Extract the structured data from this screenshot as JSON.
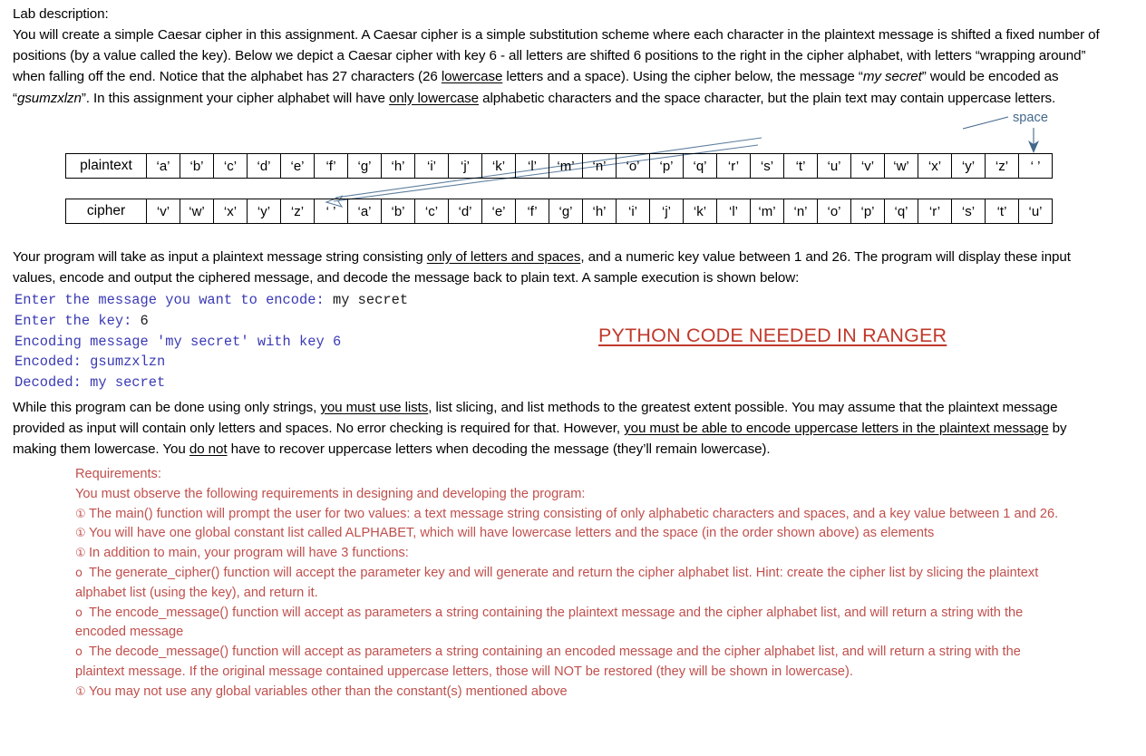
{
  "document": {
    "lab_label": "Lab description:",
    "intro_paragraph": {
      "seg1": "You will create a simple Caesar cipher in this assignment.  A Caesar cipher is a simple substitution scheme where each character in the plaintext message is shifted a fixed number of positions (by a value called the key).  Below we depict a Caesar cipher with key 6 - all letters are shifted 6 positions to the right in the cipher alphabet, with letters “wrapping around” when falling off the end.  Notice that the alphabet has 27 characters (26 ",
      "underline1": "lowercase",
      "seg2": " letters and a space).  Using the cipher below, the message “",
      "italic1": "my secret",
      "seg3": "” would be encoded as “",
      "italic2": "gsumzxlzn",
      "seg4": "”.  In this assignment your cipher alphabet will have ",
      "underline2": "only lowercase",
      "seg5": " alphabetic characters and the space character, but the plain text may contain uppercase letters."
    },
    "input_paragraph": {
      "seg1": "Your program will take as input a plaintext message string consisting ",
      "underline1": "only of letters and spaces",
      "seg2": ", and a numeric key value between 1 and 26.  The program will display these input values, encode and output the ciphered message, and decode the message back to plain text.  A sample execution is shown below:"
    },
    "lists_paragraph": {
      "seg1": "While this program can be done using only strings, ",
      "underline1": "you must use lists",
      "seg2": ", list slicing, and list methods to the greatest extent possible.  You may assume that the plaintext message provided as input will contain only letters and spaces.  No error checking is required for that.  However, ",
      "underline2": "you must be able to encode uppercase letters in the plaintext message",
      "seg3": " by making them lowercase. You ",
      "underline3": "do not",
      "seg4": " have to recover uppercase letters when decoding the message (they’ll remain lowercase)."
    }
  },
  "cipher_diagram": {
    "plaintext_label": "plaintext",
    "cipher_label": "cipher",
    "plaintext_cells": [
      "‘a’",
      "‘b’",
      "‘c’",
      "‘d’",
      "‘e’",
      "‘f’",
      "‘g’",
      "‘h’",
      "‘i’",
      "‘j’",
      "‘k’",
      "‘l’",
      "‘m’",
      "‘n’",
      "‘o’",
      "‘p’",
      "‘q’",
      "‘r’",
      "‘s’",
      "‘t’",
      "‘u’",
      "‘v’",
      "‘w’",
      "‘x’",
      "‘y’",
      "‘z’",
      "‘ ’"
    ],
    "cipher_cells": [
      "‘v’",
      "‘w’",
      "‘x’",
      "‘y’",
      "‘z’",
      "‘ ’",
      "‘a’",
      "‘b’",
      "‘c’",
      "‘d’",
      "‘e’",
      "‘f’",
      "‘g’",
      "‘h’",
      "‘i’",
      "‘j’",
      "‘k’",
      "‘l’",
      "‘m’",
      "‘n’",
      "‘o’",
      "‘p’",
      "‘q’",
      "‘r’",
      "‘s’",
      "‘t’",
      "‘u’"
    ],
    "space_annotation": "space",
    "annotation_color": "#44688c"
  },
  "console": {
    "lines": [
      {
        "prompt": "Enter the message you want to encode: ",
        "input": "my secret"
      },
      {
        "prompt": "Enter the key: ",
        "input": "6"
      },
      {
        "prompt": "Encoding message 'my secret' with key 6",
        "input": ""
      },
      {
        "prompt": "Encoded: gsumzxlzn",
        "input": ""
      },
      {
        "prompt": "Decoded: my secret",
        "input": ""
      }
    ],
    "text_color": "#3a3ab4"
  },
  "banner": {
    "text": "PYTHON CODE NEEDED IN RANGER",
    "color": "#c0392b"
  },
  "requirements": {
    "color": "#c0504d",
    "heading": "Requirements:",
    "intro": "You must observe the following requirements in designing and developing the program:",
    "bullet_glyph": "①",
    "sub_glyph": "o",
    "items": [
      {
        "type": "bullet",
        "text": "The main() function will prompt the user for two values: a text message string consisting of only alphabetic characters and spaces, and a key value between 1 and 26."
      },
      {
        "type": "bullet",
        "text": "You will have one global constant list called ALPHABET, which will have lowercase letters and the space (in the order shown above) as elements"
      },
      {
        "type": "bullet",
        "text": "In addition to main, your program will have 3 functions:"
      },
      {
        "type": "sub",
        "text": "The generate_cipher() function will accept the parameter key and will generate and return the cipher alphabet list. Hint: create the cipher list by slicing the plaintext alphabet list (using the key), and return it."
      },
      {
        "type": "sub",
        "text": "The encode_message() function will accept as parameters a string containing the plaintext message and the cipher alphabet list, and will return a string with the encoded message"
      },
      {
        "type": "sub",
        "text": "The decode_message() function will accept as parameters a string containing an encoded message and the cipher alphabet list, and will return a string with the plaintext message. If the original message contained uppercase letters, those will NOT be restored (they will be shown in lowercase)."
      },
      {
        "type": "bullet",
        "text": "You may not use any global variables other than the constant(s) mentioned above"
      }
    ]
  }
}
